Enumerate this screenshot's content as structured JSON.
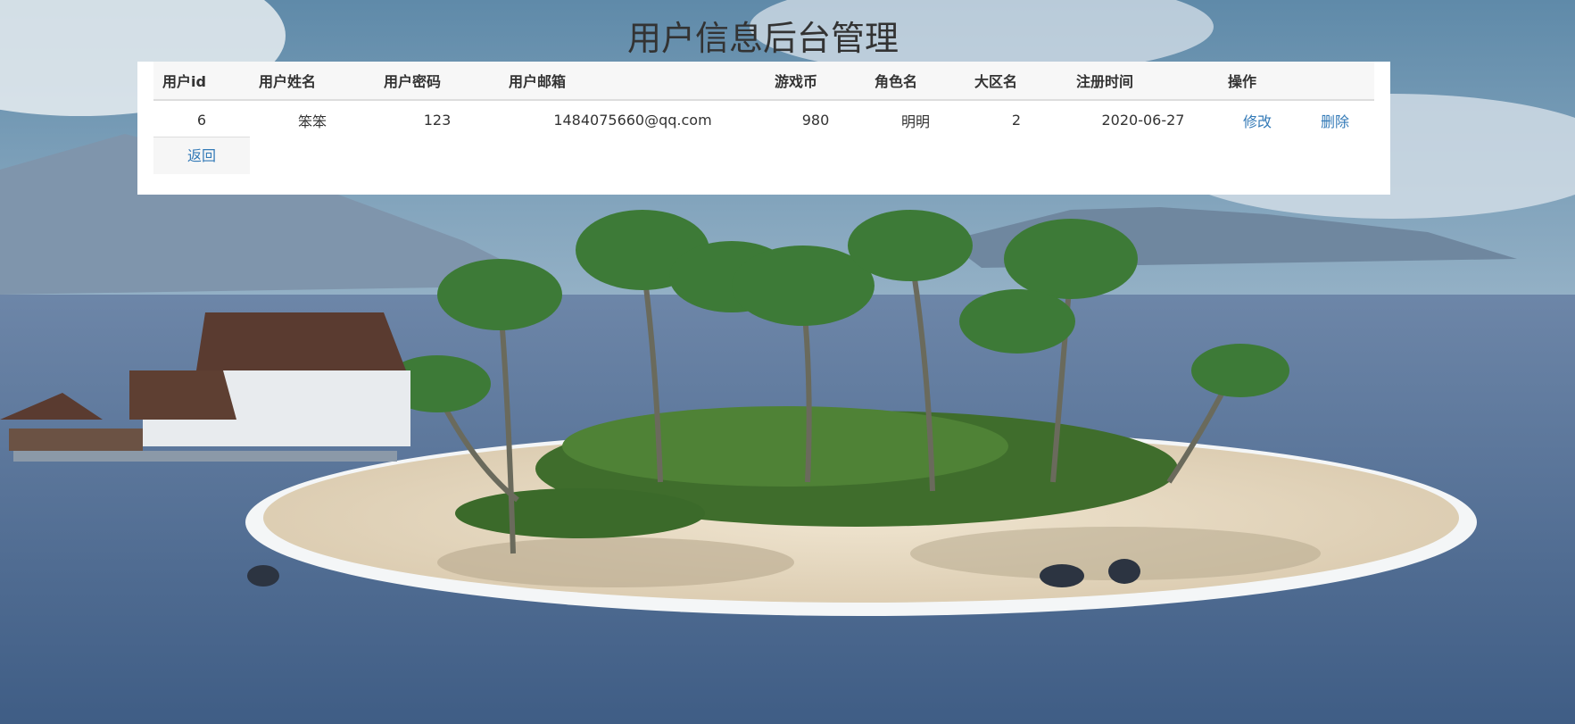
{
  "page": {
    "title": "用户信息后台管理"
  },
  "table": {
    "columns": [
      "用户id",
      "用户姓名",
      "用户密码",
      "用户邮箱",
      "游戏币",
      "角色名",
      "大区名",
      "注册时间",
      "操作"
    ],
    "rows": [
      {
        "id": "6",
        "name": "笨笨",
        "password": "123",
        "email": "1484075660@qq.com",
        "coins": "980",
        "role": "明明",
        "region": "2",
        "reg_time": "2020-06-27",
        "edit_label": "修改",
        "delete_label": "删除"
      }
    ]
  },
  "actions": {
    "back_label": "返回"
  },
  "colors": {
    "link": "#337ab7",
    "title": "#333333",
    "header_bg": "#f7f7f7"
  }
}
